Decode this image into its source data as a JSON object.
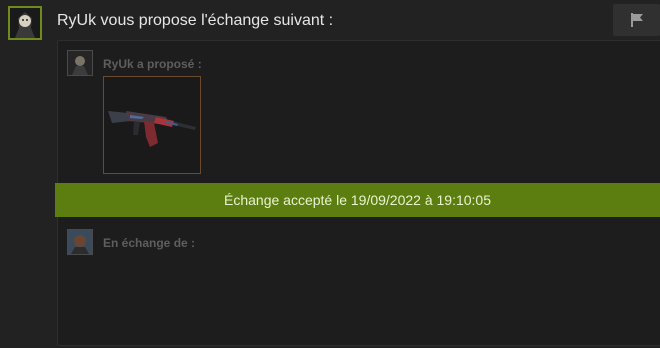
{
  "header": {
    "title": "RyUk vous propose l'échange suivant :",
    "report_icon": "flag-icon"
  },
  "offer": {
    "label": "RyUk a proposé :",
    "item_icon": "rifle-icon"
  },
  "status": {
    "text": "Échange accepté le 19/09/2022 à 19:10:05",
    "color": "#5c7e10"
  },
  "exchange": {
    "label": "En échange de :"
  },
  "colors": {
    "avatar_border": "#6f8a1f",
    "item_border": "#6b4a2e"
  }
}
